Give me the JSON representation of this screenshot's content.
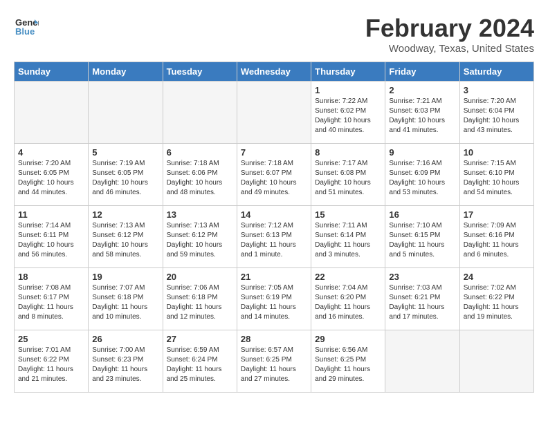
{
  "header": {
    "logo_line1": "General",
    "logo_line2": "Blue",
    "month": "February 2024",
    "location": "Woodway, Texas, United States"
  },
  "days_of_week": [
    "Sunday",
    "Monday",
    "Tuesday",
    "Wednesday",
    "Thursday",
    "Friday",
    "Saturday"
  ],
  "weeks": [
    [
      {
        "date": "",
        "info": ""
      },
      {
        "date": "",
        "info": ""
      },
      {
        "date": "",
        "info": ""
      },
      {
        "date": "",
        "info": ""
      },
      {
        "date": "1",
        "info": "Sunrise: 7:22 AM\nSunset: 6:02 PM\nDaylight: 10 hours\nand 40 minutes."
      },
      {
        "date": "2",
        "info": "Sunrise: 7:21 AM\nSunset: 6:03 PM\nDaylight: 10 hours\nand 41 minutes."
      },
      {
        "date": "3",
        "info": "Sunrise: 7:20 AM\nSunset: 6:04 PM\nDaylight: 10 hours\nand 43 minutes."
      }
    ],
    [
      {
        "date": "4",
        "info": "Sunrise: 7:20 AM\nSunset: 6:05 PM\nDaylight: 10 hours\nand 44 minutes."
      },
      {
        "date": "5",
        "info": "Sunrise: 7:19 AM\nSunset: 6:05 PM\nDaylight: 10 hours\nand 46 minutes."
      },
      {
        "date": "6",
        "info": "Sunrise: 7:18 AM\nSunset: 6:06 PM\nDaylight: 10 hours\nand 48 minutes."
      },
      {
        "date": "7",
        "info": "Sunrise: 7:18 AM\nSunset: 6:07 PM\nDaylight: 10 hours\nand 49 minutes."
      },
      {
        "date": "8",
        "info": "Sunrise: 7:17 AM\nSunset: 6:08 PM\nDaylight: 10 hours\nand 51 minutes."
      },
      {
        "date": "9",
        "info": "Sunrise: 7:16 AM\nSunset: 6:09 PM\nDaylight: 10 hours\nand 53 minutes."
      },
      {
        "date": "10",
        "info": "Sunrise: 7:15 AM\nSunset: 6:10 PM\nDaylight: 10 hours\nand 54 minutes."
      }
    ],
    [
      {
        "date": "11",
        "info": "Sunrise: 7:14 AM\nSunset: 6:11 PM\nDaylight: 10 hours\nand 56 minutes."
      },
      {
        "date": "12",
        "info": "Sunrise: 7:13 AM\nSunset: 6:12 PM\nDaylight: 10 hours\nand 58 minutes."
      },
      {
        "date": "13",
        "info": "Sunrise: 7:13 AM\nSunset: 6:12 PM\nDaylight: 10 hours\nand 59 minutes."
      },
      {
        "date": "14",
        "info": "Sunrise: 7:12 AM\nSunset: 6:13 PM\nDaylight: 11 hours\nand 1 minute."
      },
      {
        "date": "15",
        "info": "Sunrise: 7:11 AM\nSunset: 6:14 PM\nDaylight: 11 hours\nand 3 minutes."
      },
      {
        "date": "16",
        "info": "Sunrise: 7:10 AM\nSunset: 6:15 PM\nDaylight: 11 hours\nand 5 minutes."
      },
      {
        "date": "17",
        "info": "Sunrise: 7:09 AM\nSunset: 6:16 PM\nDaylight: 11 hours\nand 6 minutes."
      }
    ],
    [
      {
        "date": "18",
        "info": "Sunrise: 7:08 AM\nSunset: 6:17 PM\nDaylight: 11 hours\nand 8 minutes."
      },
      {
        "date": "19",
        "info": "Sunrise: 7:07 AM\nSunset: 6:18 PM\nDaylight: 11 hours\nand 10 minutes."
      },
      {
        "date": "20",
        "info": "Sunrise: 7:06 AM\nSunset: 6:18 PM\nDaylight: 11 hours\nand 12 minutes."
      },
      {
        "date": "21",
        "info": "Sunrise: 7:05 AM\nSunset: 6:19 PM\nDaylight: 11 hours\nand 14 minutes."
      },
      {
        "date": "22",
        "info": "Sunrise: 7:04 AM\nSunset: 6:20 PM\nDaylight: 11 hours\nand 16 minutes."
      },
      {
        "date": "23",
        "info": "Sunrise: 7:03 AM\nSunset: 6:21 PM\nDaylight: 11 hours\nand 17 minutes."
      },
      {
        "date": "24",
        "info": "Sunrise: 7:02 AM\nSunset: 6:22 PM\nDaylight: 11 hours\nand 19 minutes."
      }
    ],
    [
      {
        "date": "25",
        "info": "Sunrise: 7:01 AM\nSunset: 6:22 PM\nDaylight: 11 hours\nand 21 minutes."
      },
      {
        "date": "26",
        "info": "Sunrise: 7:00 AM\nSunset: 6:23 PM\nDaylight: 11 hours\nand 23 minutes."
      },
      {
        "date": "27",
        "info": "Sunrise: 6:59 AM\nSunset: 6:24 PM\nDaylight: 11 hours\nand 25 minutes."
      },
      {
        "date": "28",
        "info": "Sunrise: 6:57 AM\nSunset: 6:25 PM\nDaylight: 11 hours\nand 27 minutes."
      },
      {
        "date": "29",
        "info": "Sunrise: 6:56 AM\nSunset: 6:25 PM\nDaylight: 11 hours\nand 29 minutes."
      },
      {
        "date": "",
        "info": ""
      },
      {
        "date": "",
        "info": ""
      }
    ]
  ]
}
